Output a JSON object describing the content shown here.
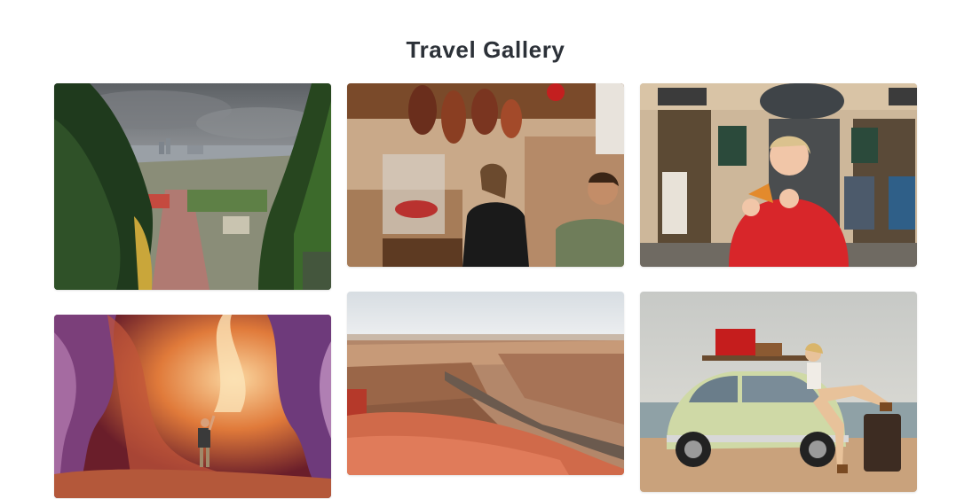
{
  "header": {
    "title": "Travel Gallery"
  },
  "gallery": {
    "photos": [
      {
        "subject": "city-view-through-jungle-cliffs"
      },
      {
        "subject": "market-with-hanging-hams"
      },
      {
        "subject": "woman-eating-pizza-street"
      },
      {
        "subject": "antelope-slot-canyon-hiker"
      },
      {
        "subject": "grand-canyon-overlook"
      },
      {
        "subject": "vintage-beetle-beach-woman"
      }
    ]
  },
  "colors": {
    "title": "#2c3138",
    "background": "#ffffff"
  }
}
